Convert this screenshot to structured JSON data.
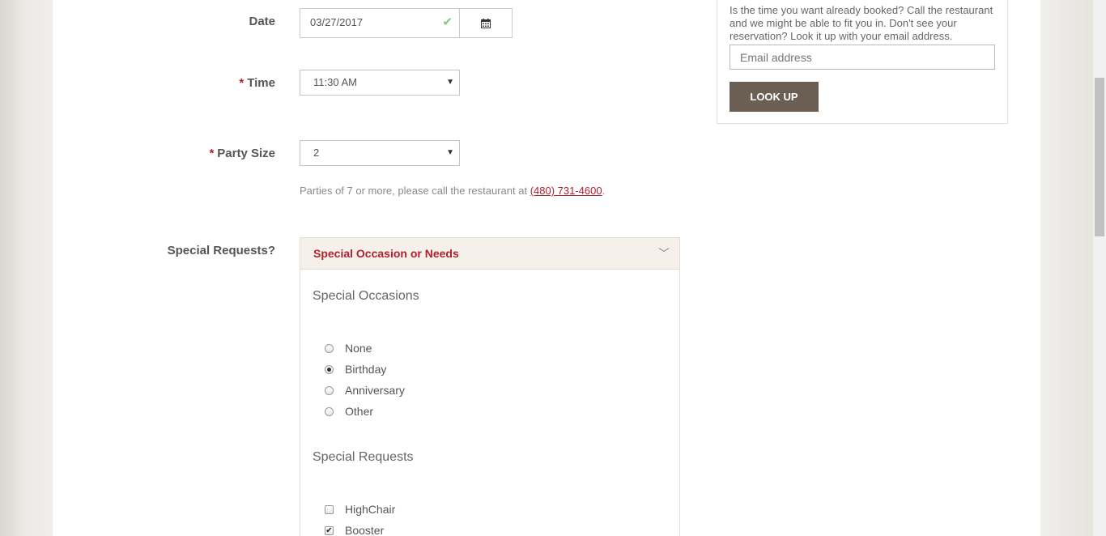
{
  "form": {
    "date_label": "Date",
    "date_value": "03/27/2017",
    "time_label": "Time",
    "time_value": "11:30 AM",
    "party_label": "Party Size",
    "party_value": "2",
    "required_mark": "*",
    "party_hint_prefix": "Parties of 7 or more, please call the restaurant at ",
    "party_hint_phone": "(480) 731-4600",
    "party_hint_suffix": ".",
    "special_label": "Special Requests?"
  },
  "special_panel": {
    "header": "Special Occasion or Needs",
    "occasions_title": "Special Occasions",
    "occasions": [
      {
        "label": "None",
        "selected": false
      },
      {
        "label": "Birthday",
        "selected": true
      },
      {
        "label": "Anniversary",
        "selected": false
      },
      {
        "label": "Other",
        "selected": false
      }
    ],
    "requests_title": "Special Requests",
    "requests": [
      {
        "label": "HighChair",
        "checked": false
      },
      {
        "label": "Booster",
        "checked": true
      }
    ]
  },
  "lookup": {
    "text": "Is the time you want already booked? Call the restaurant and we might be able to fit you in.  Don't see your reservation? Look it up with your email address.",
    "email_placeholder": "Email address",
    "button_label": "LOOK UP"
  },
  "colors": {
    "accent_red": "#b21f2d",
    "button_brown": "#6b5f54",
    "panel_header_bg": "#f5f0ea"
  }
}
